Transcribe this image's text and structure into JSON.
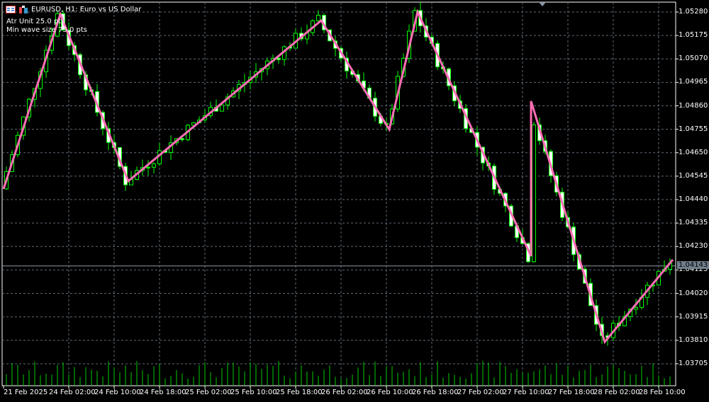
{
  "header": {
    "symbol_title": "EURUSD, H1:  Euro vs US Dollar",
    "icons": [
      "chart-list-icon",
      "indicator-icon"
    ]
  },
  "indicator": {
    "atr_unit": "Atr Unit 25.0 pts",
    "min_wave": "Min wave size 75.0 pts"
  },
  "price_axis": [
    "1.05280",
    "1.05175",
    "1.05070",
    "1.04965",
    "1.04860",
    "1.04755",
    "1.04650",
    "1.04545",
    "1.04440",
    "1.04335",
    "1.04230",
    "1.04125",
    "1.04020",
    "1.03915",
    "1.03810",
    "1.03705"
  ],
  "current_price": "1.04143",
  "time_axis": [
    "21 Feb 2025",
    "24 Feb 02:00",
    "24 Feb 10:00",
    "24 Feb 18:00",
    "25 Feb 02:00",
    "25 Feb 10:00",
    "25 Feb 18:00",
    "26 Feb 02:00",
    "26 Feb 10:00",
    "26 Feb 18:00",
    "27 Feb 02:00",
    "27 Feb 10:00",
    "27 Feb 18:00",
    "28 Feb 02:00",
    "28 Feb 10:00"
  ],
  "colors": {
    "bull": "#00ff00",
    "bear": "#ffffff",
    "zigzag": "#ff6eb4",
    "grid": "#5f6b78",
    "volume": "#00cc00"
  },
  "chart_data": {
    "type": "candlestick",
    "ylim": [
      1.03652,
      1.05333
    ],
    "bars": 118,
    "zigzag": [
      [
        0,
        1.04488
      ],
      [
        10,
        1.0527
      ],
      [
        22,
        1.04523
      ],
      [
        56,
        1.05242
      ],
      [
        68,
        1.04754
      ],
      [
        73,
        1.0528
      ],
      [
        93,
        1.04187
      ],
      [
        93,
        1.04881
      ],
      [
        106,
        1.03803
      ],
      [
        118,
        1.04171
      ]
    ]
  }
}
